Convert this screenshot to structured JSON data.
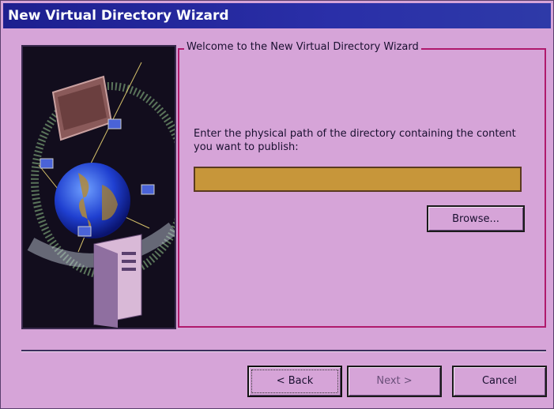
{
  "window": {
    "title": "New Virtual Directory Wizard"
  },
  "group": {
    "title": "Welcome to the New Virtual Directory Wizard"
  },
  "prompt": {
    "text": "Enter the physical path of the directory containing the content you want to publish:"
  },
  "path_input": {
    "value": "",
    "placeholder": ""
  },
  "buttons": {
    "browse": "Browse...",
    "back": "< Back",
    "next": "Next >",
    "cancel": "Cancel"
  },
  "colors": {
    "background": "#d6a4d8",
    "titlebar": "#1d1f8f",
    "input_fill": "#c7963a",
    "group_border": "#b01a6c"
  },
  "icons": [
    "globe-network-illustration",
    "server-icon",
    "computer-icon"
  ]
}
